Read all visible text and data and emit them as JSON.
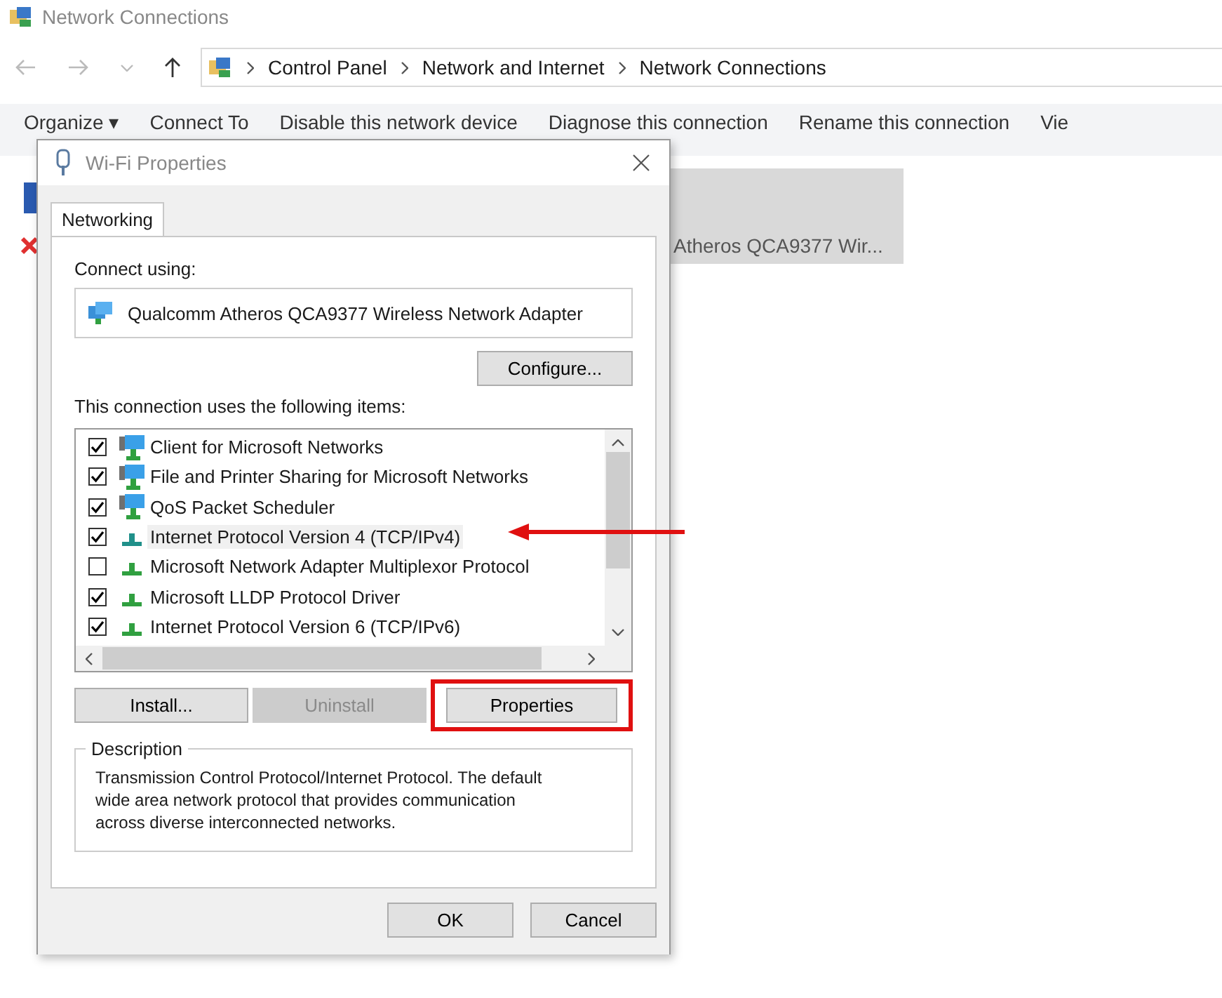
{
  "window": {
    "title": "Network Connections"
  },
  "breadcrumb": [
    "Control Panel",
    "Network and Internet",
    "Network Connections"
  ],
  "toolbar": [
    "Organize ▾",
    "Connect To",
    "Disable this network device",
    "Diagnose this connection",
    "Rename this connection",
    "Vie"
  ],
  "connection": {
    "adapter": "Atheros QCA9377 Wir...",
    "selected": true
  },
  "dialog": {
    "title": "Wi-Fi Properties",
    "tabs": [
      {
        "label": "Networking",
        "selected": true
      }
    ],
    "connect_using_label": "Connect using:",
    "adapter": "Qualcomm Atheros QCA9377 Wireless Network Adapter",
    "configure_button": "Configure...",
    "items_label": "This connection uses the following items:",
    "items": [
      {
        "kind": "client",
        "label": "Client for Microsoft Networks",
        "checked": true,
        "selected": false
      },
      {
        "kind": "client",
        "label": "File and Printer Sharing for Microsoft Networks",
        "checked": true,
        "selected": false
      },
      {
        "kind": "client",
        "label": "QoS Packet Scheduler",
        "checked": true,
        "selected": false
      },
      {
        "kind": "protocol",
        "label": "Internet Protocol Version 4 (TCP/IPv4)",
        "checked": true,
        "selected": true
      },
      {
        "kind": "protocol",
        "label": "Microsoft Network Adapter Multiplexor Protocol",
        "checked": false,
        "selected": false
      },
      {
        "kind": "protocol",
        "label": "Microsoft LLDP Protocol Driver",
        "checked": true,
        "selected": false
      },
      {
        "kind": "protocol",
        "label": "Internet Protocol Version 6 (TCP/IPv6)",
        "checked": true,
        "selected": false
      }
    ],
    "actions": [
      {
        "label": "Install...",
        "disabled": false,
        "highlighted": false
      },
      {
        "label": "Uninstall",
        "disabled": true,
        "highlighted": false
      },
      {
        "label": "Properties",
        "disabled": false,
        "highlighted": true
      }
    ],
    "description_label": "Description",
    "description": "Transmission Control Protocol/Internet Protocol. The default wide area network protocol that provides communication across diverse interconnected networks.",
    "buttons": [
      "OK",
      "Cancel"
    ]
  }
}
